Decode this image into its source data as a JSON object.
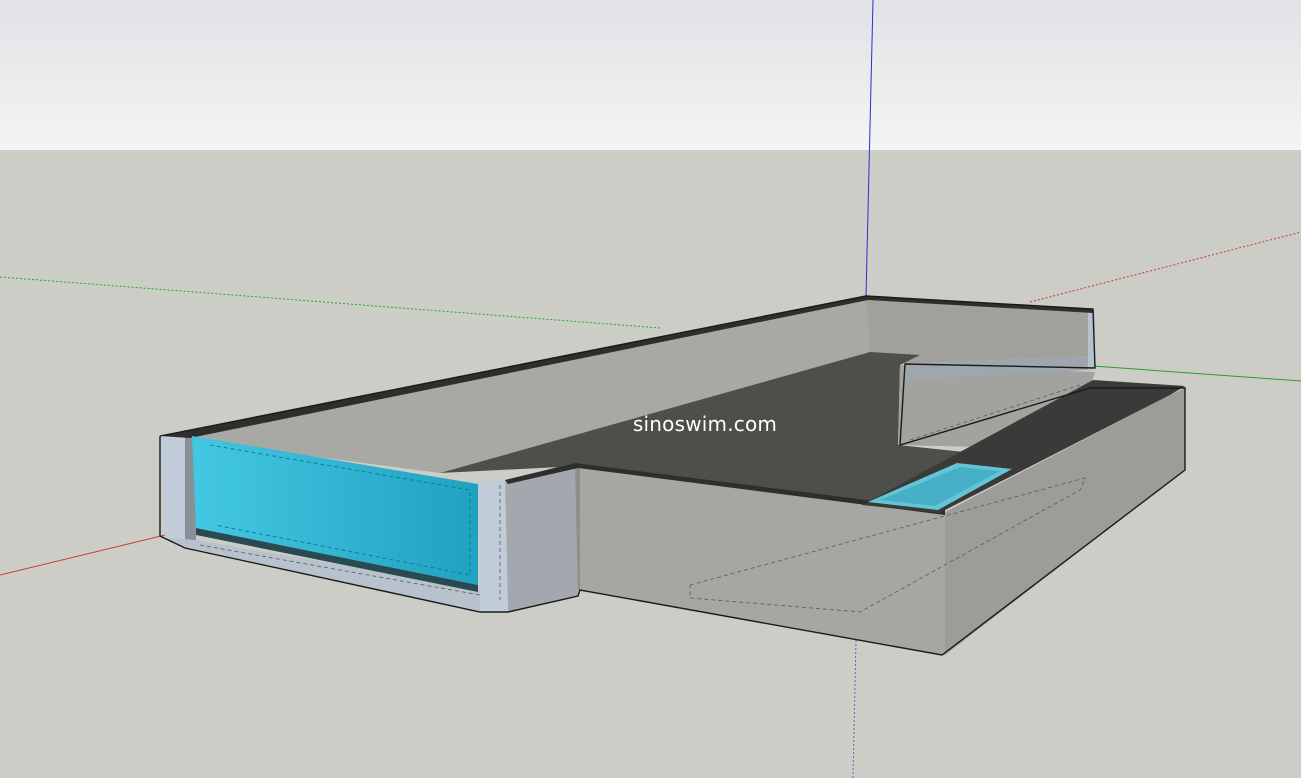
{
  "scene": {
    "watermark": "sinoswim.com",
    "colors": {
      "sky_top": "#e2e4e6",
      "sky_bottom": "#f2f3f4",
      "ground": "#cdcdc7",
      "axis_red": "#d03a3a",
      "axis_green": "#2aa02a",
      "axis_blue": "#2830d0",
      "wall_face": "#a6a6a2",
      "wall_top": "#3a3a38",
      "pool_floor": "#4e4e4a",
      "acrylic_glass": "#22b6d6",
      "small_pool_water": "#64c4d8",
      "column": "#c0ccd8"
    },
    "objects": [
      {
        "name": "pool-shell",
        "kind": "concrete"
      },
      {
        "name": "acrylic-window",
        "kind": "glass"
      },
      {
        "name": "spa-pool",
        "kind": "water"
      }
    ]
  }
}
